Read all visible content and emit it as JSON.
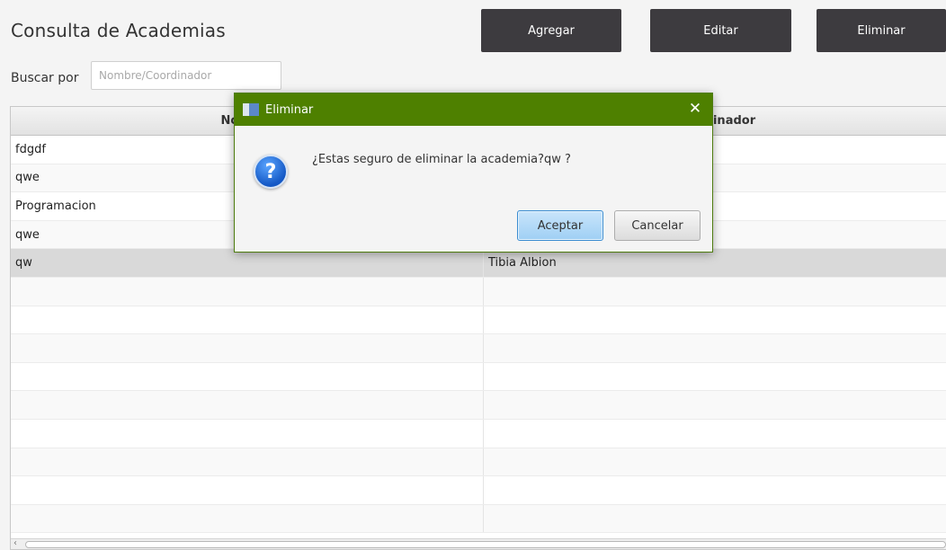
{
  "header": {
    "title": "Consulta de Academias"
  },
  "toolbar": {
    "agregar_label": "Agregar",
    "editar_label": "Editar",
    "eliminar_label": "Eliminar"
  },
  "search": {
    "label": "Buscar por",
    "placeholder": "Nombre/Coordinador",
    "value": ""
  },
  "table": {
    "columns": [
      "Nombre",
      "Coordinador"
    ],
    "rows": [
      {
        "nombre": "fdgdf",
        "coordinador": ""
      },
      {
        "nombre": "qwe",
        "coordinador": ""
      },
      {
        "nombre": "Programacion",
        "coordinador": ""
      },
      {
        "nombre": "qwe",
        "coordinador": ""
      },
      {
        "nombre": "qw",
        "coordinador": "Tibia Albion"
      },
      {
        "nombre": "",
        "coordinador": ""
      },
      {
        "nombre": "",
        "coordinador": ""
      },
      {
        "nombre": "",
        "coordinador": ""
      },
      {
        "nombre": "",
        "coordinador": ""
      },
      {
        "nombre": "",
        "coordinador": ""
      },
      {
        "nombre": "",
        "coordinador": ""
      },
      {
        "nombre": "",
        "coordinador": ""
      },
      {
        "nombre": "",
        "coordinador": ""
      },
      {
        "nombre": "",
        "coordinador": ""
      }
    ],
    "selected_row": 4
  },
  "dialog": {
    "title": "Eliminar",
    "message": "¿Estas seguro de eliminar la academia?qw ?",
    "accept_label": "Aceptar",
    "cancel_label": "Cancelar",
    "close_glyph": "✕",
    "icon_glyph": "?"
  },
  "icons": {
    "dialog": "question-icon",
    "window": "app-window-icon",
    "close": "close-icon"
  },
  "colors": {
    "titlebar": "#4e8000",
    "toolbar_button": "#3d3b3f",
    "selected_row": "#d9d9d9",
    "accept_border": "#3c8dd1"
  }
}
